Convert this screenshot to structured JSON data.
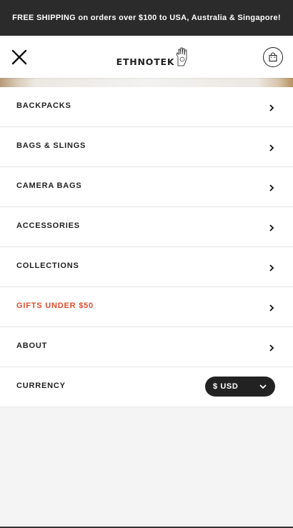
{
  "promo": {
    "text": "FREE SHIPPING on orders over $100 to USA, Australia & Singapore!"
  },
  "header": {
    "logo_text": "ETHNOTEK"
  },
  "menu": {
    "items": [
      {
        "label": "BACKPACKS"
      },
      {
        "label": "BAGS & SLINGS"
      },
      {
        "label": "CAMERA BAGS"
      },
      {
        "label": "ACCESSORIES"
      },
      {
        "label": "COLLECTIONS"
      },
      {
        "label": "GIFTS UNDER $50",
        "highlight_color": "#e04a2c"
      },
      {
        "label": "ABOUT"
      }
    ]
  },
  "currency": {
    "label": "CURRENCY",
    "selected": "$ USD"
  },
  "icons": {
    "close": "close-icon",
    "cart": "shopping-bag-icon",
    "chevron": "chevron-right-icon",
    "dropdown": "chevron-down-icon",
    "logo": "hand-logo-icon"
  }
}
